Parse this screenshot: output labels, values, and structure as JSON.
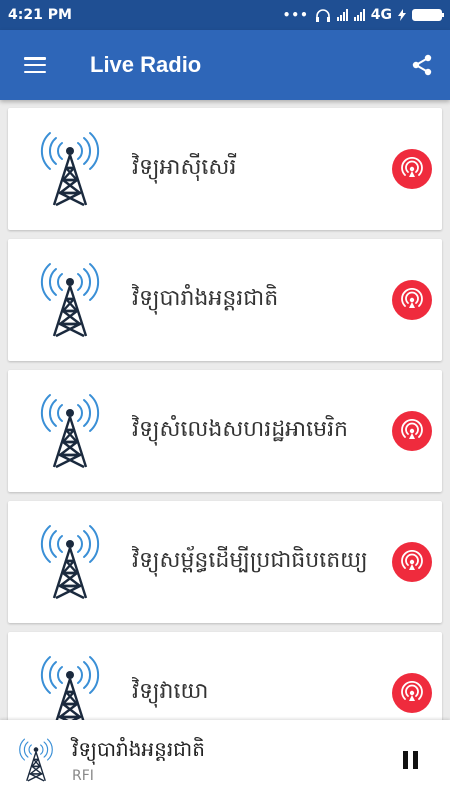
{
  "status_bar": {
    "time": "4:21 PM",
    "network": "4G"
  },
  "app_bar": {
    "title": "Live Radio",
    "menu_icon": "hamburger-menu-icon",
    "share_icon": "share-icon"
  },
  "stations": [
    {
      "name": "វិទ្យុអាស៊ីសេរី"
    },
    {
      "name": "វិទ្យុបារាំងអន្តរជាតិ"
    },
    {
      "name": "វិទ្យុសំលេងសហរដ្ឋអាមេរិក"
    },
    {
      "name": "វិទ្យុសម្ព័ន្ធដើម្បីប្រជាធិបតេយ្យ"
    },
    {
      "name": "វិទ្យុវាយោ"
    }
  ],
  "now_playing": {
    "name": "វិទ្យុបារាំងអន្តរជាតិ",
    "subtitle": "RFI",
    "control_icon": "pause-icon"
  },
  "colors": {
    "status_bar": "#1f4f93",
    "app_bar": "#2e66b8",
    "play_button": "#ef2b3d",
    "tower": "#1b2a3e",
    "signal_waves": "#3a8fd6"
  }
}
